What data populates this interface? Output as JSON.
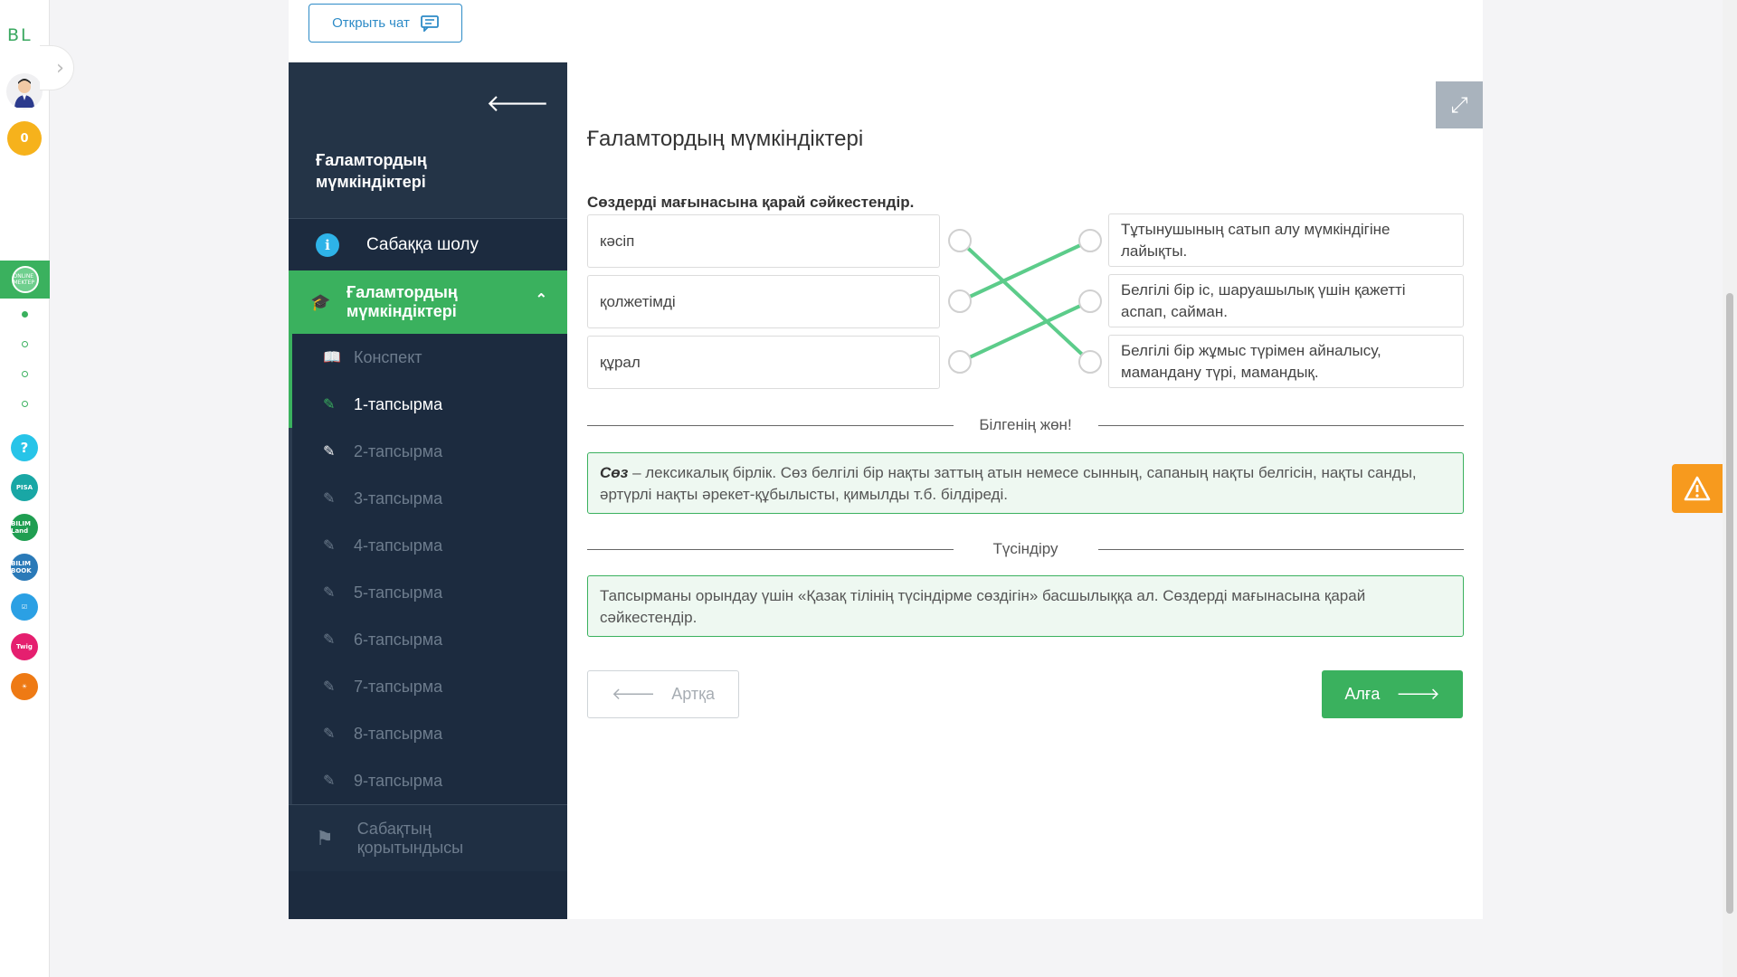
{
  "rail": {
    "logo": "BL",
    "coins": "0",
    "active_app": "ONLINE MEKTEP",
    "apps": [
      {
        "name": "help",
        "glyph": "?",
        "color": "#27c4e8"
      },
      {
        "name": "pisa",
        "glyph": "PISA",
        "color": "#19a7a5"
      },
      {
        "name": "bilimland",
        "glyph": "BILIM Land",
        "color": "#1f9e51"
      },
      {
        "name": "bilimbook",
        "glyph": "BILIM BOOK",
        "color": "#2a7ab8"
      },
      {
        "name": "test",
        "glyph": "☑",
        "color": "#2ba0e4"
      },
      {
        "name": "twig",
        "glyph": "Twig",
        "color": "#e51f6f"
      },
      {
        "name": "mektep",
        "glyph": "☀",
        "color": "#ee7a14"
      }
    ]
  },
  "header": {
    "chat_label": "Открыть чат"
  },
  "nav": {
    "title": "Ғаламтордың мүмкіндіктері",
    "overview": "Сабаққа шолу",
    "section": "Ғаламтордың мүмкіндіктері",
    "items": [
      "Конспект",
      "1-тапсырма",
      "2-тапсырма",
      "3-тапсырма",
      "4-тапсырма",
      "5-тапсырма",
      "6-тапсырма",
      "7-тапсырма",
      "8-тапсырма",
      "9-тапсырма"
    ],
    "summary": "Сабақтың қорытындысы"
  },
  "task": {
    "title": "Ғаламтордың мүмкіндіктері",
    "instruction": "Сөздерді мағынасына қарай сәйкестендір.",
    "left": [
      "кәсіп",
      "қолжетімді",
      "құрал"
    ],
    "right": [
      "Тұтынушының сатып алу мүмкіндігіне лайықты.",
      "Белгілі бір іс, шаруашылық үшін қажетті аспап, сайман.",
      "Белгілі бір жұмыс түрімен айналысу, мамандану түрі, мамандық."
    ],
    "connections": [
      [
        0,
        2
      ],
      [
        1,
        0
      ],
      [
        2,
        1
      ]
    ],
    "line_color": "#5ccc8a"
  },
  "hint": {
    "label": "Білгенің жөн!",
    "term": "Сөз",
    "text": " – лексикалық бірлік. Сөз белгілі бір нақты заттың атын немесе сынның, сапаның нақты белгісін, нақты санды, әртүрлі нақты әрекет-құбылысты, қимылды т.б. білдіреді."
  },
  "explain": {
    "label": "Түсіндіру",
    "text": "Тапсырманы орындау үшін «Қазақ тілінің түсіндірме сөздігін» басшылыққа ал. Сөздерді мағынасына қарай сәйкестендір."
  },
  "buttons": {
    "back": "Артқа",
    "next": "Алға"
  },
  "colors": {
    "accent": "#3ab15e",
    "nav_bg": "#1c2b3f",
    "link": "#2d8bc7",
    "warning": "#f79a1e"
  }
}
